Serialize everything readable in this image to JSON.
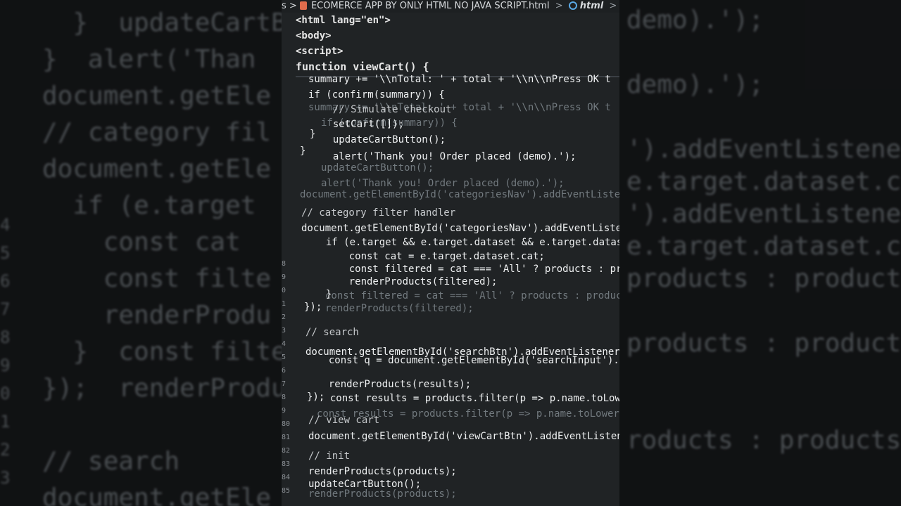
{
  "breadcrumb": {
    "prefix": "s >",
    "file": "ECOMERCE APP BY ONLY HTML NO JAVA SCRIPT.html",
    "sep": ">",
    "node": "html",
    "tail": ">"
  },
  "sticky_scroll": [
    "<html lang=\"en\">",
    "<body>",
    "<script>",
    "function viewCart() {"
  ],
  "code_lines": [
    "summary += '\\\\nTotal: ' + total + '\\\\n\\\\nPress OK t",
    "if (confirm(summary)) {",
    "  // Simulate checkout",
    "  setCart([]);",
    "  updateCartButton();",
    "  alert('Thank you! Order placed (demo).');",
    "}",
    "}",
    "// category filter handler",
    "document.getElementById('categoriesNav').addEventListene",
    "  if (e.target && e.target.dataset && e.target.dataset.c",
    "    const cat = e.target.dataset.cat;",
    "    const filtered = cat === 'All' ? products : products.",
    "    renderProducts(filtered);",
    "  }",
    "});",
    "// search",
    "document.getElementById('searchBtn').addEventListener('cl",
    "  const q = document.getElementById('searchInput').value.t",
    "  const results = products.filter(p => p.name.toLowerCase(",
    "  renderProducts(results);",
    "});",
    "// view cart",
    "document.getElementById('viewCartBtn').addEventListener('cl",
    "// init",
    "renderProducts(products);",
    "updateCartButton();"
  ],
  "ghost_lines": [
    "summary += '\\\\nTotal: ' + total + '\\\\n\\\\nPress OK t",
    "if (confirm(summary)) {",
    "updateCartButton();",
    "alert('Thank you! Order placed (demo).');",
    "document.getElementById('categoriesNav').addEventListene",
    "const filtered = cat === 'All' ? products : products.",
    "renderProducts(filtered);",
    "const results = products.filter(p => p.name.toLowerCase(",
    "renderProducts(products);"
  ],
  "gutter_numbers": [
    "8",
    "9",
    "0",
    "1",
    "2",
    "3",
    "4",
    "5",
    "6",
    "7",
    "8",
    "9",
    "80",
    "81",
    "82",
    "83",
    "84",
    "85"
  ],
  "left_panel_text": [
    "  }  updateCartB",
    "}  alert('Than",
    "document.getEle",
    "// category fil",
    "document.getEle",
    "  if (e.target",
    "    const cat",
    "    const filte",
    "    renderProdu",
    "  }  const filte",
    "});  renderProdu",
    "",
    "// search",
    "document.getEle"
  ],
  "left_panel_numbers": [
    "4",
    "5",
    "6",
    "7",
    "8",
    "9",
    "0",
    "1",
    "2",
    "3"
  ],
  "right_panel_text": [
    "demo).');",
    "",
    "demo).');",
    "",
    "').addEventListene",
    "e.target.dataset.c",
    "').addEventListene",
    "e.target.dataset.ca",
    "products : products.",
    "",
    "products : products.",
    "",
    "",
    "roducts : products."
  ]
}
